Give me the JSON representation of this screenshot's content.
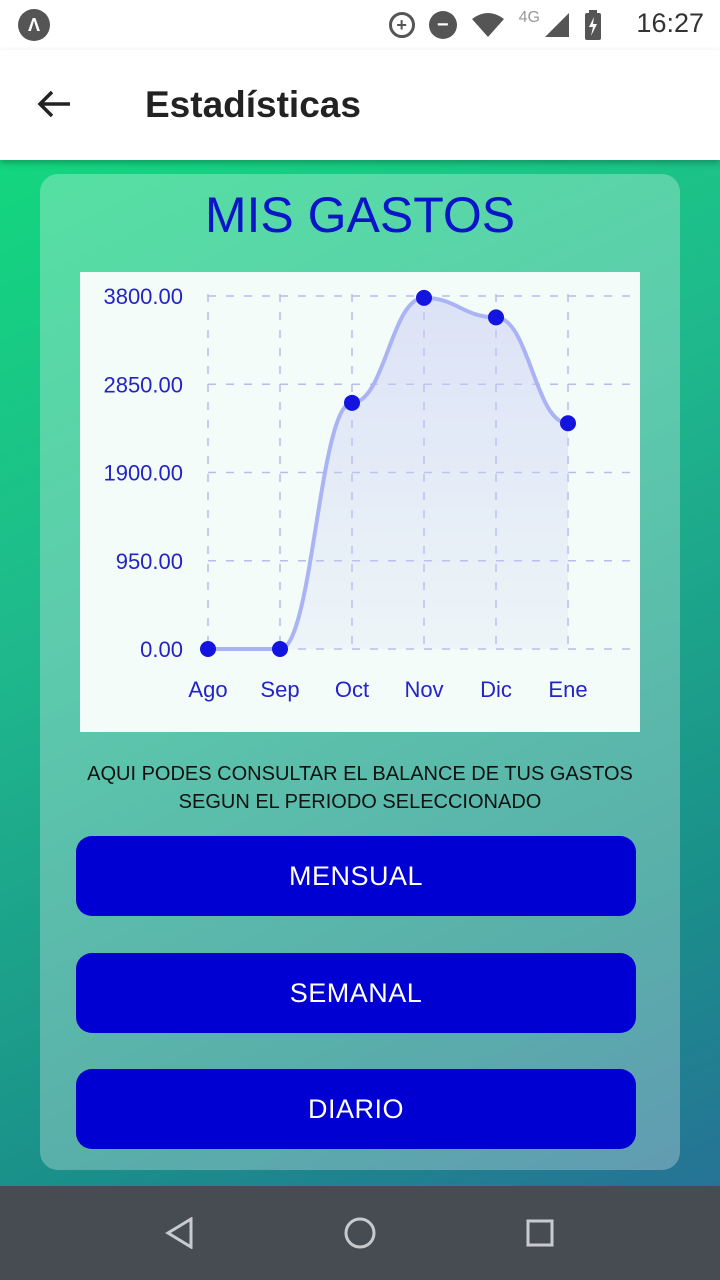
{
  "status_bar": {
    "app_icon": "Λ",
    "network": "4G",
    "time": "16:27",
    "icons": [
      "data-saver-icon",
      "do-not-disturb-icon",
      "wifi-icon",
      "signal-icon",
      "battery-charging-icon"
    ]
  },
  "app_bar": {
    "back_icon": "back-arrow-icon",
    "title": "Estadísticas"
  },
  "card": {
    "title": "MIS GASTOS",
    "info_text": "AQUI PODES CONSULTAR EL BALANCE DE TUS GASTOS SEGUN EL PERIODO SELECCIONADO",
    "buttons": {
      "monthly": "MENSUAL",
      "weekly": "SEMANAL",
      "daily": "DIARIO"
    }
  },
  "chart_data": {
    "type": "line",
    "categories": [
      "Ago",
      "Sep",
      "Oct",
      "Nov",
      "Dic",
      "Ene"
    ],
    "series": [
      {
        "values": [
          0,
          0,
          2650,
          3780,
          3570,
          2430
        ]
      }
    ],
    "yticks": [
      "0.00",
      "950.00",
      "1900.00",
      "2850.00",
      "3800.00"
    ],
    "ylim": [
      0,
      3800
    ],
    "grid": true,
    "smooth": true,
    "colors": {
      "line": "#aab4f5",
      "point": "#1414e0",
      "tick_label": "#2323c8",
      "grid": "#b8bcf0"
    }
  },
  "nav_bar": {
    "items": [
      "back-triangle-icon",
      "home-circle-icon",
      "recents-square-icon"
    ]
  }
}
